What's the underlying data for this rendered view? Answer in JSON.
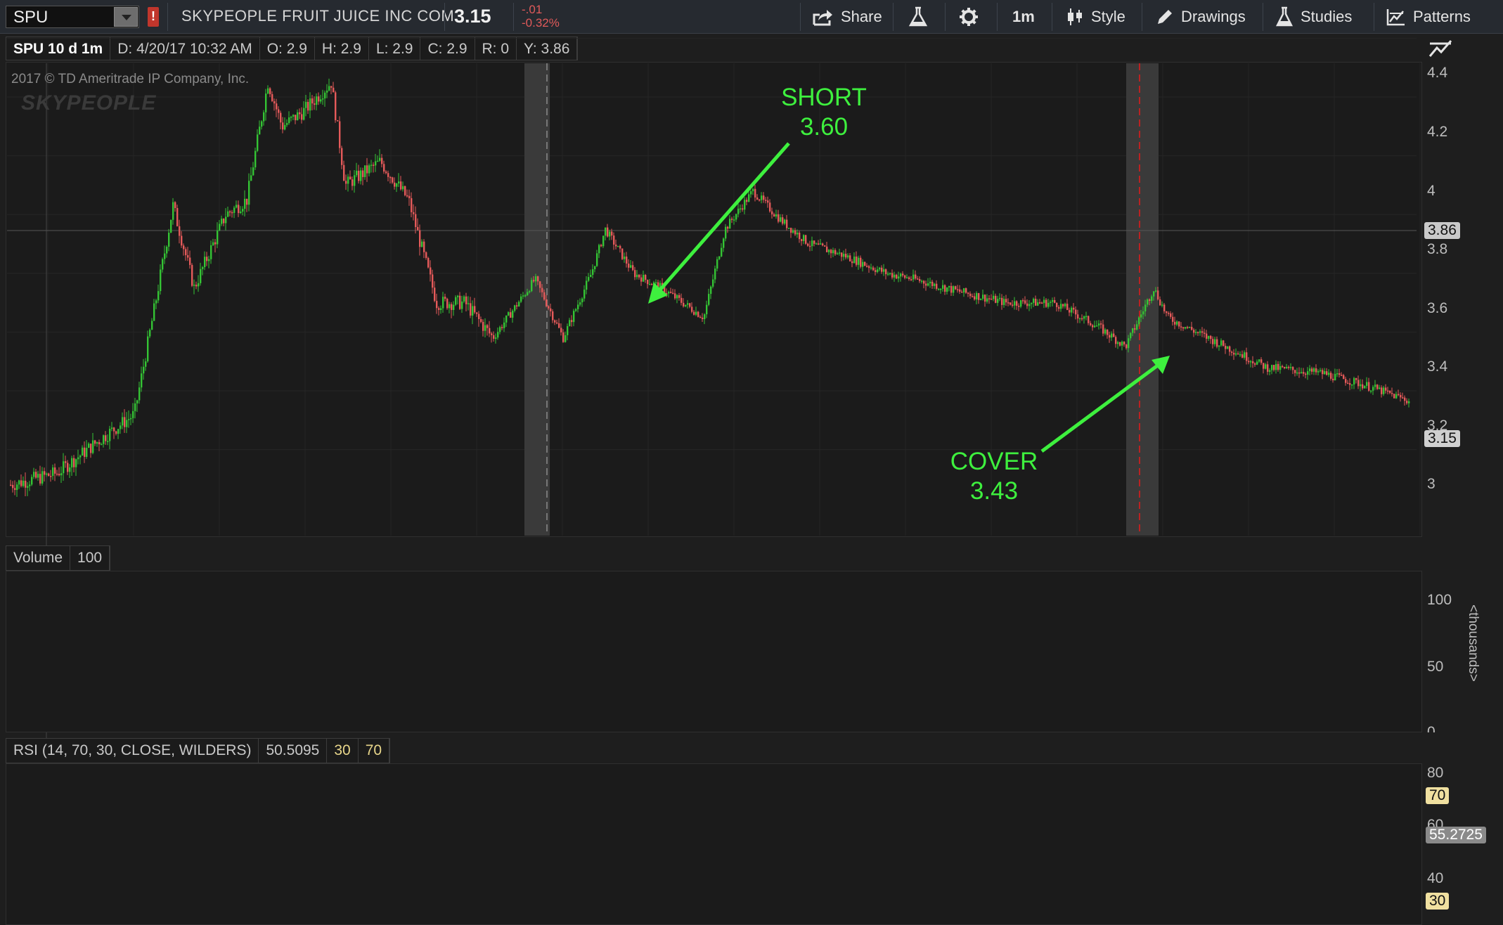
{
  "toolbar": {
    "symbol": "SPU",
    "company": "SKYPEOPLE FRUIT JUICE INC COM",
    "last": "3.15",
    "change": "-.01",
    "change_pct": "-0.32%",
    "share_label": "Share",
    "timeframe_label": "1m",
    "style_label": "Style",
    "drawings_label": "Drawings",
    "studies_label": "Studies",
    "patterns_label": "Patterns"
  },
  "header": {
    "title": "SPU 10 d 1m",
    "date": "D:  4/20/17 10:32 AM",
    "open": "O:  2.9",
    "high": "H:  2.9",
    "low": "L:  2.9",
    "close": "C:  2.9",
    "range": "R:  0",
    "y": "Y:  3.86"
  },
  "chart": {
    "copyright": "2017 © TD Ameritrade IP Company, Inc.",
    "watermark": "SKYPEOPLE",
    "price_axis": [
      "4.4",
      "4.2",
      "4",
      "3.8",
      "3.6",
      "3.4",
      "3.2",
      "3"
    ],
    "crosshair_price": "3.86",
    "last_price": "3.15",
    "annotation_short": "SHORT",
    "annotation_short_price": "3.60",
    "annotation_cover": "COVER",
    "annotation_cover_price": "3.43"
  },
  "volume": {
    "label": "Volume",
    "value": "100",
    "axis": [
      "100",
      "50",
      "0"
    ],
    "unit_label": "<thousands>"
  },
  "rsi": {
    "label": "RSI (14, 70, 30, CLOSE, WILDERS)",
    "value": "50.5095",
    "low_level": "30",
    "high_level": "70",
    "axis": [
      "80",
      "60",
      "40"
    ],
    "current": "55.2725",
    "line_70": "70",
    "line_30": "30"
  },
  "colors": {
    "up": "#34c434",
    "down": "#e55a5a",
    "volume": "#1f6fa3",
    "rsi_line": "#9a9a9a",
    "rsi_level": "#e8d68a",
    "annotation": "#3ef03e"
  }
}
